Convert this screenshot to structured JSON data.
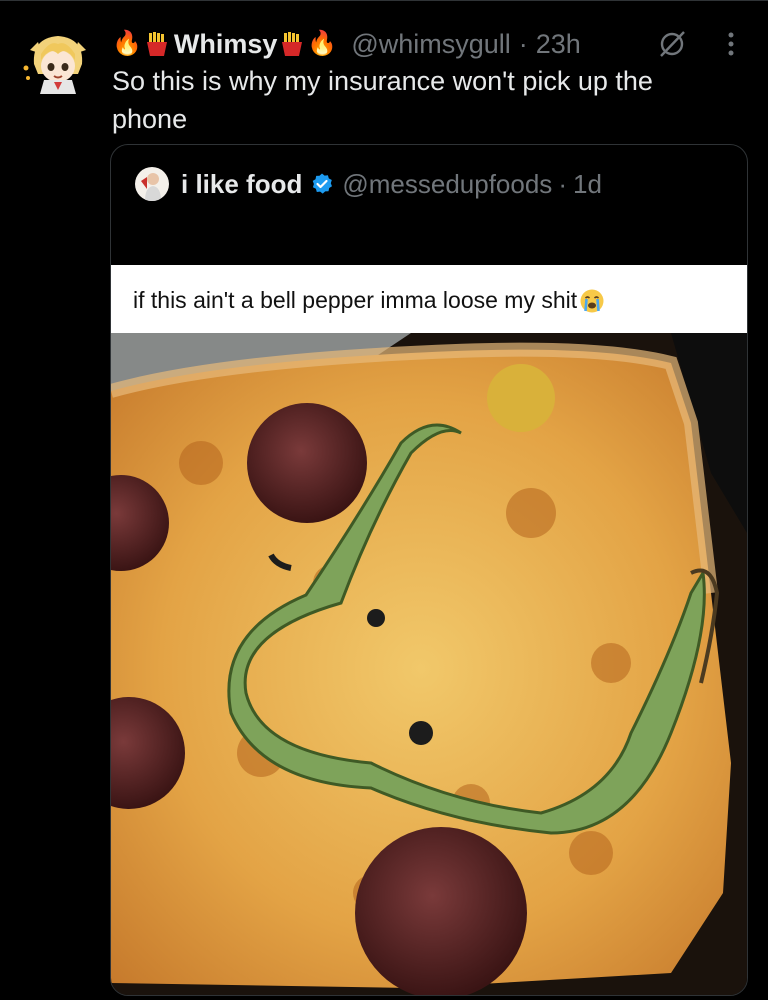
{
  "post": {
    "emoji_left": "🔥",
    "name": "Whimsy",
    "emoji_right": "🔥",
    "fries_icon": "fries-icon",
    "handle": "@whimsygull",
    "separator": "·",
    "time": "23h",
    "text": "So this is why my insurance won't pick up the phone"
  },
  "quoted": {
    "name": "i like food",
    "handle": "@messedupfoods",
    "separator": "·",
    "time": "1d",
    "caption": "if this ain't a bell pepper imma loose my shit",
    "caption_emoji": "sob-face-icon",
    "photo_subject": ""
  },
  "icons": {
    "grok": "grok-icon",
    "more": "more-vertical-icon",
    "verified": "verified-badge-icon"
  },
  "colors": {
    "background": "#000000",
    "text_primary": "#e7e9ea",
    "text_secondary": "#71767b",
    "border": "#2f3336",
    "verified": "#1d9bf0"
  }
}
